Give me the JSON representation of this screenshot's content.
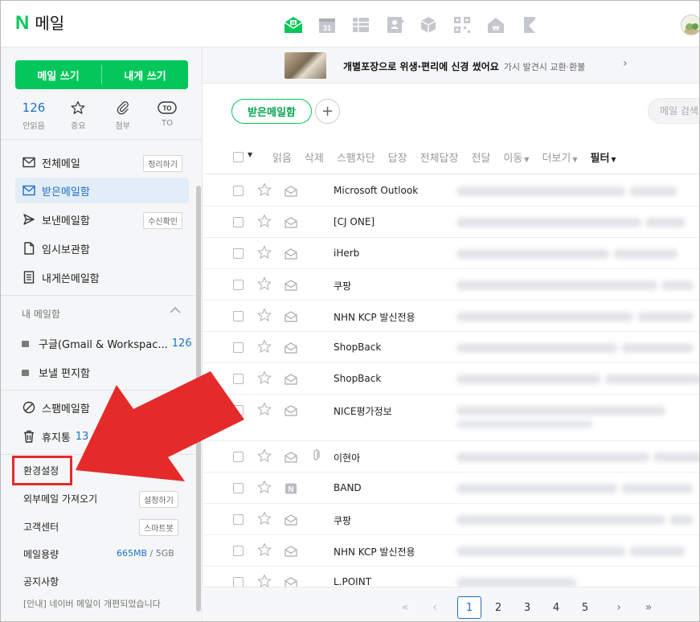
{
  "header": {
    "logo_letter": "N",
    "logo_text": "메일",
    "apps": [
      "mail-app-icon",
      "calendar-app-icon",
      "contacts-list-icon",
      "address-book-icon",
      "cube-icon",
      "qr-icon",
      "home-icon",
      "bookmark-icon"
    ],
    "calendar_day": "31"
  },
  "sidebar": {
    "compose_label": "메일 쓰기",
    "self_compose_label": "내게 쓰기",
    "quick": [
      {
        "top": "126",
        "label": "안읽음"
      },
      {
        "top": "",
        "label": "중요"
      },
      {
        "top": "",
        "label": "첨부"
      },
      {
        "top": "TO",
        "label": "TO"
      }
    ],
    "menu": [
      {
        "label": "전체메일",
        "badge": "정리하기"
      },
      {
        "label": "받은메일함",
        "badge": ""
      },
      {
        "label": "보낸메일함",
        "badge": "수신확인"
      },
      {
        "label": "임시보관함",
        "badge": ""
      },
      {
        "label": "내게쓴메일함",
        "badge": ""
      }
    ],
    "my_mailbox_title": "내 메일함",
    "folders": [
      {
        "label": "구글(Gmail & Workspac...",
        "count": "126"
      },
      {
        "label": "보낼 편지함",
        "count": ""
      }
    ],
    "spam_label": "스팸메일함",
    "trash_label": "휴지통",
    "trash_count": "13",
    "settings_label": "환경설정",
    "import_label": "외부메일 가져오기",
    "import_badge": "설정하기",
    "support_label": "고객센터",
    "support_badge": "스마트봇",
    "quota_label": "메일용량",
    "quota_used": "665MB",
    "quota_sep": "/",
    "quota_total": "5GB",
    "notice_label": "공지사항",
    "notice_text": "[안내] 네이버 메일이 개편되었습니다"
  },
  "banner": {
    "text": "개별포장으로 위생·편리에 신경 썼어요",
    "sub": "가시 발견시 교환·환불",
    "chevron": "›"
  },
  "mailbox": {
    "tab_label": "받은메일함",
    "add_tab": "+",
    "search_placeholder": "메일 검색"
  },
  "toolbar": {
    "items": [
      "읽음",
      "삭제",
      "스팸차단",
      "답장",
      "전체답장",
      "전달",
      "이동",
      "더보기",
      "필터"
    ]
  },
  "mails": [
    {
      "sender": "Microsoft Outlook",
      "envelope": "open",
      "clip": false
    },
    {
      "sender": "[CJ ONE]",
      "envelope": "open",
      "clip": false
    },
    {
      "sender": "iHerb",
      "envelope": "open",
      "clip": false
    },
    {
      "sender": "쿠팡",
      "envelope": "open",
      "clip": false
    },
    {
      "sender": "NHN KCP 발신전용",
      "envelope": "open",
      "clip": false
    },
    {
      "sender": "ShopBack",
      "envelope": "open",
      "clip": false
    },
    {
      "sender": "ShopBack",
      "envelope": "open",
      "clip": false
    },
    {
      "sender": "NICE평가정보",
      "envelope": "open",
      "clip": false
    },
    {
      "sender": "이현아",
      "envelope": "open",
      "clip": true
    },
    {
      "sender": "BAND",
      "envelope": "band",
      "clip": false
    },
    {
      "sender": "쿠팡",
      "envelope": "open",
      "clip": false
    },
    {
      "sender": "NHN KCP 발신전용",
      "envelope": "open",
      "clip": false
    },
    {
      "sender": "L.POINT",
      "envelope": "open",
      "clip": false
    }
  ],
  "pager": {
    "first": "«",
    "prev": "‹",
    "pages": [
      "1",
      "2",
      "3",
      "4",
      "5"
    ],
    "current": "1",
    "next": "›",
    "last": "»"
  },
  "colors": {
    "brand_green": "#03c75a",
    "active_blue": "#1f6fc0",
    "annotation_red": "#e52a2a"
  }
}
